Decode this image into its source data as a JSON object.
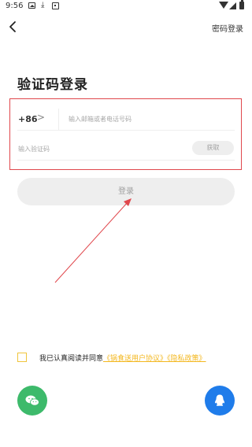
{
  "status_bar": {
    "time": "9:56",
    "download_glyph": "⤓",
    "icons": [
      "image-icon",
      "download-icon",
      "app-icon",
      "wifi-icon",
      "signal-icon",
      "battery-icon"
    ]
  },
  "header": {
    "back_icon": "back-chevron-icon",
    "password_login": "密码登录"
  },
  "title": "验证码登录",
  "form": {
    "country_code": "+86",
    "country_arrow": ">",
    "phone_placeholder": "输入邮箱或者电话号码",
    "phone_value": "",
    "code_placeholder": "输入验证码",
    "code_value": "",
    "get_code_label": "获取"
  },
  "login_button": "登录",
  "agreement": {
    "checked": false,
    "text": "我已认真阅读并同意",
    "user_agreement": "《锅食送用户协议》",
    "privacy_policy": "《隐私政策》"
  },
  "social": {
    "wechat_icon": "wechat-icon",
    "qq_icon": "qq-icon"
  },
  "colors": {
    "accent_yellow": "#f3b71e",
    "annotation_red": "#e0474c",
    "wechat_green": "#3dba6b",
    "qq_blue": "#1f7cea",
    "button_gray": "#eeeeee"
  }
}
